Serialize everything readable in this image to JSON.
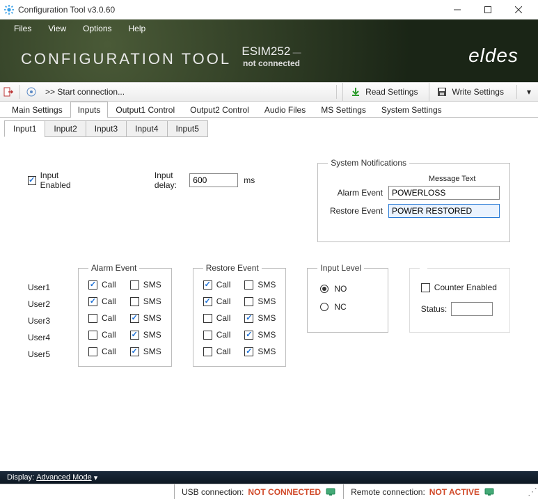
{
  "window": {
    "title": "Configuration Tool v3.0.60"
  },
  "menu": {
    "files": "Files",
    "view": "View",
    "options": "Options",
    "help": "Help"
  },
  "header": {
    "title": "CONFIGURATION TOOL",
    "device": "ESIM252",
    "dash": "—",
    "status": "not connected",
    "brand": "eldes"
  },
  "toolbar": {
    "start_connection": ">> Start connection...",
    "read_settings": "Read Settings",
    "write_settings": "Write Settings"
  },
  "main_tabs": [
    "Main Settings",
    "Inputs",
    "Output1 Control",
    "Output2 Control",
    "Audio Files",
    "MS Settings",
    "System Settings"
  ],
  "main_tab_active": 1,
  "input_tabs": [
    "Input1",
    "Input2",
    "Input3",
    "Input4",
    "Input5"
  ],
  "input_tab_active": 0,
  "form": {
    "input_enabled_label": "Input Enabled",
    "input_enabled": true,
    "input_delay_label": "Input delay:",
    "input_delay_value": "600",
    "input_delay_unit": "ms"
  },
  "notifications": {
    "legend": "System Notifications",
    "message_text": "Message Text",
    "alarm_label": "Alarm Event",
    "alarm_value": "POWERLOSS",
    "restore_label": "Restore Event",
    "restore_value": "POWER RESTORED"
  },
  "events": {
    "alarm_legend": "Alarm Event",
    "restore_legend": "Restore Event",
    "col_call": "Call",
    "col_sms": "SMS",
    "users": [
      "User1",
      "User2",
      "User3",
      "User4",
      "User5"
    ],
    "alarm": [
      {
        "call": true,
        "sms": false
      },
      {
        "call": true,
        "sms": false
      },
      {
        "call": false,
        "sms": true
      },
      {
        "call": false,
        "sms": true
      },
      {
        "call": false,
        "sms": true
      }
    ],
    "restore": [
      {
        "call": true,
        "sms": false
      },
      {
        "call": true,
        "sms": false
      },
      {
        "call": false,
        "sms": true
      },
      {
        "call": false,
        "sms": true
      },
      {
        "call": false,
        "sms": true
      }
    ]
  },
  "input_level": {
    "legend": "Input Level",
    "no_label": "NO",
    "nc_label": "NC",
    "value": "NO"
  },
  "counter": {
    "enabled_label": "Counter Enabled",
    "enabled": false,
    "status_label": "Status:",
    "status_value": ""
  },
  "modebar": {
    "display": "Display:",
    "mode": "Advanced Mode",
    "caret": "▾"
  },
  "status": {
    "usb_label": "USB connection:",
    "usb_value": "NOT CONNECTED",
    "remote_label": "Remote connection:",
    "remote_value": "NOT ACTIVE"
  }
}
